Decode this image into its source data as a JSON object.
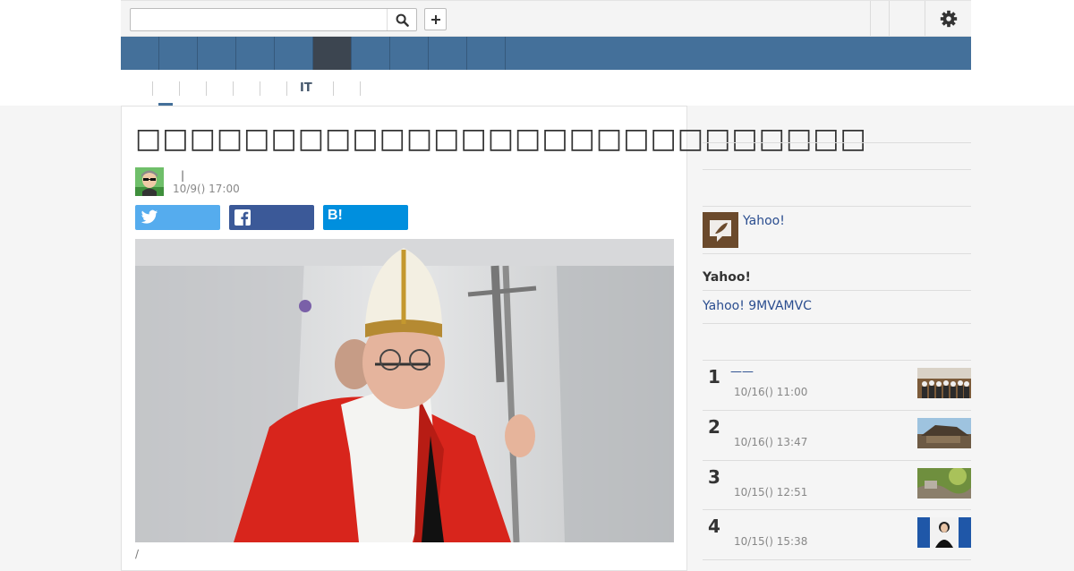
{
  "header": {
    "search": {
      "placeholder": "",
      "value": ""
    },
    "icons": {
      "search": "search-icon",
      "add": "plus-icon",
      "settings": "gear-icon"
    }
  },
  "colors": {
    "nav": "#44709a",
    "nav_active": "#3c4550",
    "twitter": "#55acee",
    "facebook": "#3b5998",
    "hatena": "#008fde",
    "link": "#2a4d8f"
  },
  "nav": {
    "items": [
      "",
      "",
      "",
      "",
      "",
      "",
      "",
      "",
      "",
      ""
    ],
    "active_index": 5
  },
  "subnav": {
    "tabs": [
      "",
      "",
      "",
      "",
      "",
      "IT",
      "",
      ""
    ],
    "active_index": 0
  },
  "article": {
    "title": "□□□□□□□□□□□□□□□□□□□□□□□□□□□",
    "author": "|",
    "date": "10/9() 17:00",
    "share": {
      "twitter": "",
      "facebook": "",
      "hatena_icon": "B!"
    },
    "caption": "/"
  },
  "sidebar": {
    "author_link": "Yahoo!",
    "heading": "Yahoo!",
    "promo_link": "Yahoo! 9MVAMVC",
    "ranking": [
      {
        "rank": "1",
        "title": "——",
        "date": "10/16() 11:00"
      },
      {
        "rank": "2",
        "title": "",
        "date": "10/16() 13:47"
      },
      {
        "rank": "3",
        "title": "",
        "date": "10/15() 12:51"
      },
      {
        "rank": "4",
        "title": "",
        "date": "10/15() 15:38"
      }
    ]
  }
}
